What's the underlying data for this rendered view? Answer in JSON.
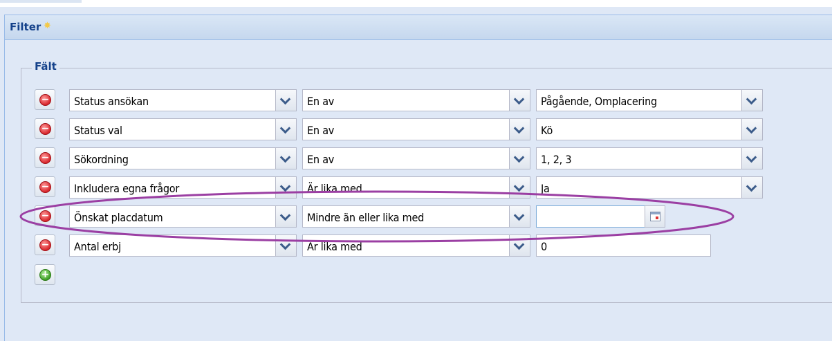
{
  "panel": {
    "title": "Filter"
  },
  "fieldset": {
    "legend": "Fält"
  },
  "rows": [
    {
      "field": "Status ansökan",
      "operator": "En av",
      "value": "Pågående, Omplacering",
      "value_type": "combo"
    },
    {
      "field": "Status val",
      "operator": "En av",
      "value": "Kö",
      "value_type": "combo"
    },
    {
      "field": "Sökordning",
      "operator": "En av",
      "value": "1, 2, 3",
      "value_type": "combo"
    },
    {
      "field": "Inkludera egna frågor",
      "operator": "Är lika med",
      "value": "Ja",
      "value_type": "combo"
    },
    {
      "field": "Önskat placdatum",
      "operator": "Mindre än eller lika med",
      "value": "",
      "value_type": "date"
    },
    {
      "field": "Antal erbj",
      "operator": "Är lika med",
      "value": "0",
      "value_type": "number"
    }
  ],
  "icons": {
    "remove": "minus-circle-icon",
    "add": "plus-circle-icon",
    "dropdown": "chevron-down-icon",
    "calendar": "calendar-icon",
    "star": "star-icon"
  },
  "colors": {
    "panel_bg": "#dfe8f6",
    "header_title": "#15428b",
    "highlight_ellipse": "#9b3fa3",
    "remove_button": "#d8262c",
    "add_button": "#3e9f26"
  }
}
